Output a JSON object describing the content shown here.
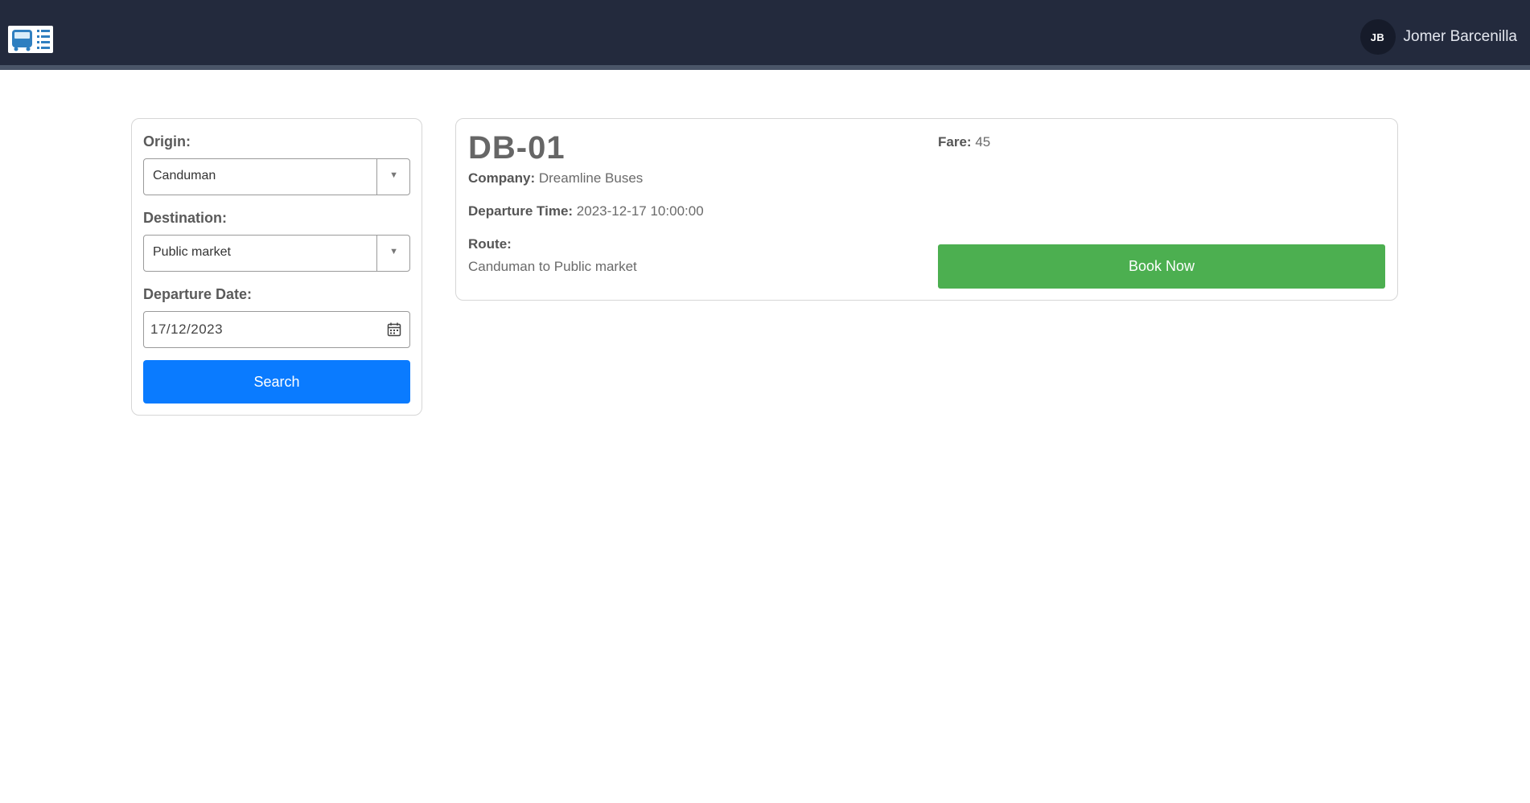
{
  "header": {
    "logo_icon": "bus-ticket-icon",
    "user": {
      "initials": "JB",
      "name": "Jomer Barcenilla"
    }
  },
  "search": {
    "origin_label": "Origin:",
    "origin_value": "Canduman",
    "destination_label": "Destination:",
    "destination_value": "Public market",
    "date_label": "Departure Date:",
    "date_value": "17/12/2023",
    "search_button": "Search"
  },
  "result": {
    "bus_code": "DB-01",
    "company_label": "Company:",
    "company_value": "Dreamline Buses",
    "departure_label": "Departure Time:",
    "departure_value": "2023-12-17 10:00:00",
    "route_label": "Route:",
    "route_value": "Canduman to Public market",
    "fare_label": "Fare:",
    "fare_value": "45",
    "book_button": "Book Now"
  },
  "colors": {
    "topbar": "#232a3d",
    "search_button": "#0a7bff",
    "book_button": "#4caf50"
  }
}
